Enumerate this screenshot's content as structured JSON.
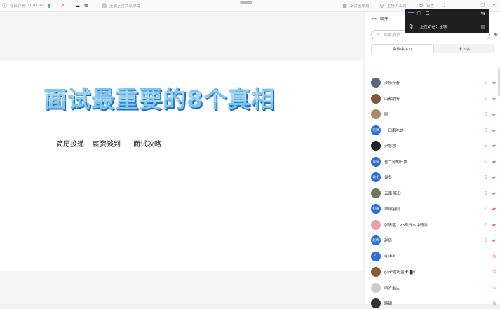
{
  "topbar": {
    "meeting_info": "会议详情",
    "timer": "01:01:10",
    "sharing_status": "王敏正在共享屏幕",
    "presenter_layout": "演讲者布局",
    "host_tools": "主持人工具",
    "settings": "设置"
  },
  "slide": {
    "title": "面试最重要的8个真相",
    "subtitles": [
      "简历投递",
      "薪资谈判",
      "面试攻略"
    ]
  },
  "panel": {
    "chat_label": "聊天",
    "search_placeholder": "搜索成员",
    "tabs": [
      "会议中(41)",
      "未入会"
    ],
    "speaking": "正在讲话：王敏"
  },
  "members": [
    {
      "name": "沙捞寺春",
      "avatar_text": "",
      "avatar_color": "#5a6a7a",
      "camera": true
    },
    {
      "name": "山都朋呀",
      "avatar_text": "",
      "avatar_color": "#7a5a3a",
      "camera": true
    },
    {
      "name": "剧",
      "avatar_text": "",
      "avatar_color": "#a78a6a",
      "camera": true
    },
    {
      "name": "一口南吃饼",
      "avatar_text": "吃饼",
      "avatar_color": "#2d6fd6",
      "camera": true
    },
    {
      "name": "尹慧慧",
      "avatar_text": "",
      "avatar_color": "#222222",
      "camera": true
    },
    {
      "name": "吾二邨的日猫",
      "avatar_text": "日猫",
      "avatar_color": "#2d6fd6",
      "camera": true
    },
    {
      "name": "袁冬",
      "avatar_text": "袁冬",
      "avatar_color": "#2d6fd6",
      "camera": true
    },
    {
      "name": "云南 斯旧",
      "avatar_text": "",
      "avatar_color": "#6a7a5a",
      "camera": true
    },
    {
      "name": "早阳担阔",
      "avatar_text": "担阔",
      "avatar_color": "#2d6fd6",
      "camera": true
    },
    {
      "name": "张清茗、23专升本中药学",
      "avatar_text": "",
      "avatar_color": "#e8a0b0",
      "camera": true
    },
    {
      "name": "赵倩",
      "avatar_text": "赵倩",
      "avatar_color": "#2d6fd6",
      "camera": true
    },
    {
      "name": "cjxbd",
      "avatar_text": "C",
      "avatar_color": "#2d6fd6",
      "camera": false
    },
    {
      "name": "g𝑐𝑑°遨吩金𝒅ᵈ·▇d",
      "avatar_text": "",
      "avatar_color": "#8a5a3a",
      "camera": false
    },
    {
      "name": "西岁金生",
      "avatar_text": "",
      "avatar_color": "#cccccc",
      "camera": false
    },
    {
      "name": "路甜",
      "avatar_text": "",
      "avatar_color": "#333333",
      "camera": false
    }
  ],
  "colors": {
    "accent": "#2d6fd6",
    "muted_mic": "#e57373",
    "title_fill": "#7ec6f0"
  }
}
